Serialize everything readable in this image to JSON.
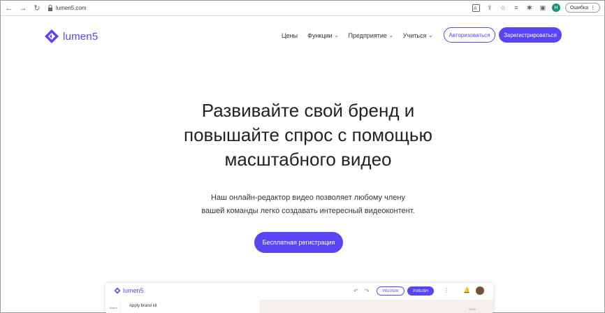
{
  "browser": {
    "url": "lumen5.com",
    "error_label": "Ошибка",
    "profile_initial": "Н"
  },
  "site": {
    "logo_text": "lumen5",
    "nav": [
      {
        "label": "Цены",
        "has_dropdown": false
      },
      {
        "label": "Функции",
        "has_dropdown": true
      },
      {
        "label": "Предприятие",
        "has_dropdown": true
      },
      {
        "label": "Учиться",
        "has_dropdown": true
      }
    ],
    "login_label": "Авторизоваться",
    "register_label": "Зарегистрироваться",
    "brand_color": "#5846f6"
  },
  "hero": {
    "title_line1": "Развивайте свой бренд и",
    "title_line2": "повышайте спрос с помощью",
    "title_line3": "масштабного видео",
    "subtitle_line1": "Наш онлайн-редактор видео позволяет любому члену",
    "subtitle_line2": "вашей команды легко создавать интересный видеоконтент.",
    "cta_label": "Бесплатная регистрация"
  },
  "preview": {
    "logo_text": "lumen5",
    "preview_label": "PREVIEW",
    "publish_label": "PUBLISH",
    "side_label": "Brand",
    "brand_kit_label": "Apply brand kit",
    "time_label": "00:05"
  }
}
